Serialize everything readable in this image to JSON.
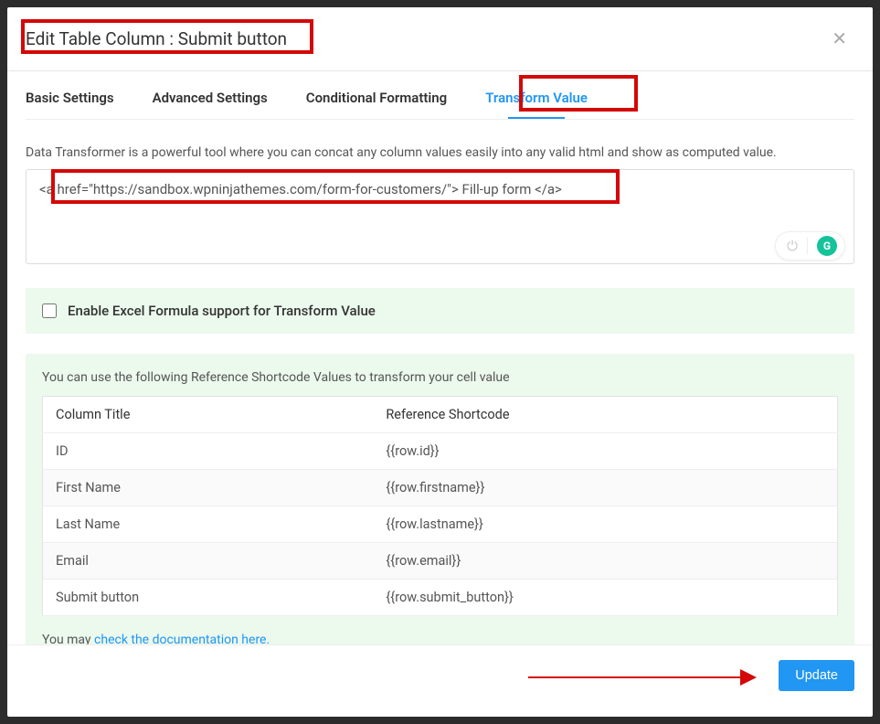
{
  "modal": {
    "title": "Edit Table Column : Submit button"
  },
  "tabs": {
    "basic": "Basic Settings",
    "advanced": "Advanced Settings",
    "conditional": "Conditional Formatting",
    "transform": "Transform Value"
  },
  "transform": {
    "description": "Data Transformer is a powerful tool where you can concat any column values easily into any valid html and show as computed value.",
    "value": "<a href=\"https://sandbox.wpninjathemes.com/form-for-customers/\"> Fill-up form </a>",
    "excelLabel": "Enable Excel Formula support for Transform Value"
  },
  "reference": {
    "intro": "You can use the following Reference Shortcode Values to transform your cell value",
    "headers": {
      "col": "Column Title",
      "code": "Reference Shortcode"
    },
    "rows": [
      {
        "title": "ID",
        "code": "{{row.id}}"
      },
      {
        "title": "First Name",
        "code": "{{row.firstname}}"
      },
      {
        "title": "Last Name",
        "code": "{{row.lastname}}"
      },
      {
        "title": "Email",
        "code": "{{row.email}}"
      },
      {
        "title": "Submit button",
        "code": "{{row.submit_button}}"
      }
    ],
    "docPrefix": "You may ",
    "docLink": "check the documentation here."
  },
  "footer": {
    "update": "Update"
  }
}
